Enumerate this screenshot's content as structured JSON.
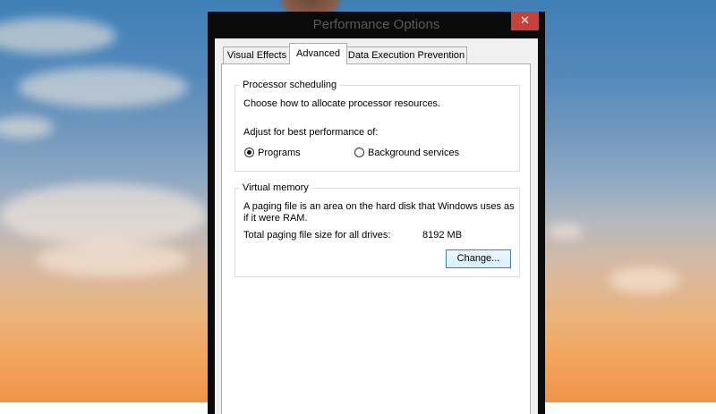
{
  "window": {
    "title": "Performance Options",
    "close_glyph": "✕"
  },
  "tabs": [
    {
      "label": "Visual Effects",
      "active": false
    },
    {
      "label": "Advanced",
      "active": true
    },
    {
      "label": "Data Execution Prevention",
      "active": false
    }
  ],
  "processor_scheduling": {
    "title": "Processor scheduling",
    "description": "Choose how to allocate processor resources.",
    "adjust_label": "Adjust for best performance of:",
    "options": [
      {
        "label": "Programs",
        "selected": true
      },
      {
        "label": "Background services",
        "selected": false
      }
    ]
  },
  "virtual_memory": {
    "title": "Virtual memory",
    "description_line1": "A paging file is an area on the hard disk that Windows uses as",
    "description_line2": "if it were RAM.",
    "total_label": "Total paging file size for all drives:",
    "total_value": "8192 MB",
    "change_button": "Change..."
  },
  "colors": {
    "close_button": "#c7403a",
    "window_frame": "#0b0b0b",
    "button_border": "#3c7fb1"
  }
}
